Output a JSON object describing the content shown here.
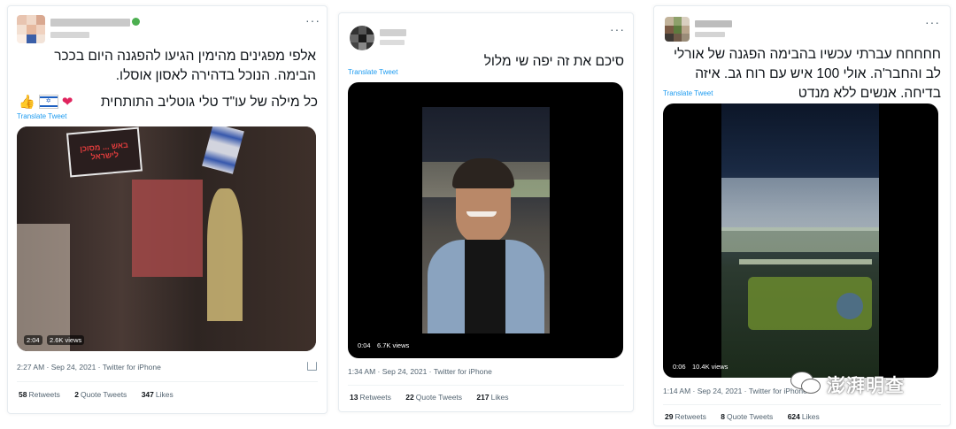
{
  "tweets": [
    {
      "text": "אלפי מפגינים מהימין הגיעו להפגנה היום בככר הבימה. הנוכל בדהירה לאסון אוסלו.",
      "text2": "כל מילה של עו\"ד טלי גוטליב התותחית",
      "translate": "Translate Tweet",
      "duration": "2:04",
      "views": "2.6K views",
      "time": "2:27 AM · Sep 24, 2021 · Twitter for iPhone",
      "retweets_count": "58",
      "retweets_label": "Retweets",
      "quotes_count": "2",
      "quotes_label": "Quote Tweets",
      "likes_count": "347",
      "likes_label": "Likes",
      "sign_text": "באש ... מסוכן לישראל"
    },
    {
      "text": "סיכם את זה יפה שי מלול",
      "translate": "Translate Tweet",
      "duration": "0:04",
      "views": "6.7K views",
      "time": "1:34 AM · Sep 24, 2021 · Twitter for iPhone",
      "retweets_count": "13",
      "retweets_label": "Retweets",
      "quotes_count": "22",
      "quotes_label": "Quote Tweets",
      "likes_count": "217",
      "likes_label": "Likes"
    },
    {
      "text": "חחחחח עברתי עכשיו בהבימה הפגנה של אורלי לב והחבר'ה. אולי 100 איש עם רוח גב. איזה בדיחה. אנשים ללא מנדט",
      "translate": "Translate Tweet",
      "duration": "0:06",
      "views": "10.4K views",
      "time": "1:14 AM · Sep 24, 2021 · Twitter for iPhone",
      "retweets_count": "29",
      "retweets_label": "Retweets",
      "quotes_count": "8",
      "quotes_label": "Quote Tweets",
      "likes_count": "624",
      "likes_label": "Likes"
    }
  ],
  "watermark": "澎湃明查",
  "icons": [
    "more-icon",
    "thumbs-up-icon",
    "israel-flag-icon",
    "heart-icon",
    "share-icon",
    "wechat-logo-icon",
    "play-video"
  ],
  "colors": {
    "link": "#1d9bf0",
    "muted": "#536471",
    "heart": "#e0245e"
  }
}
